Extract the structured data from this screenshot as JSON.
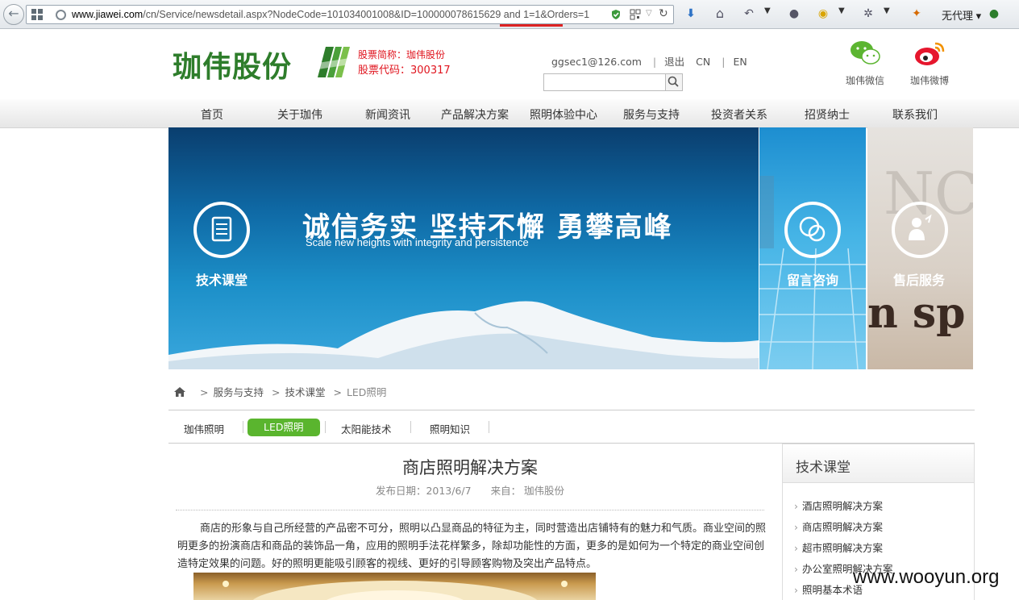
{
  "browser": {
    "url_domain": "www.jiawei.com",
    "url_path": "/cn/Service/newsdetail.aspx?NodeCode=101034001008&ID=100000078615629 and 1=1&Orders=1",
    "proxy_label": "无代理"
  },
  "header": {
    "logo_text": "珈伟股份",
    "stock_name": "股票简称：珈伟股份",
    "stock_code": "股票代码：300317",
    "user_email": "ggsec1@126.com",
    "logout": "退出",
    "lang_cn": "CN",
    "lang_en": "EN",
    "search_placeholder": "",
    "wechat_label": "珈伟微信",
    "weibo_label": "珈伟微博"
  },
  "menu": [
    "首页",
    "关于珈伟",
    "新闻资讯",
    "产品解决方案",
    "照明体验中心",
    "服务与支持",
    "投资者关系",
    "招贤纳士",
    "联系我们"
  ],
  "banner": {
    "left_label": "技术课堂",
    "slogan": "诚信务实  坚持不懈  勇攀高峰",
    "slogan_en": "Scale new heights with integrity and persistence",
    "side1_label": "留言咨询",
    "side2_label": "售后服务"
  },
  "breadcrumb": [
    "服务与支持",
    "技术课堂",
    "LED照明"
  ],
  "sub_tabs": [
    "珈伟照明",
    "LED照明",
    "太阳能技术",
    "照明知识"
  ],
  "article": {
    "title": "商店照明解决方案",
    "date": "发布日期：2013/6/7",
    "source": "来自： 珈伟股份",
    "body": "商店的形象与自己所经营的产品密不可分，照明以凸显商品的特征为主，同时营造出店铺特有的魅力和气质。商业空间的照明更多的扮演商店和商品的装饰品一角，应用的照明手法花样繁多，除却功能性的方面，更多的是如何为一个特定的商业空间创造特定效果的问题。好的照明更能吸引顾客的视线、更好的引导顾客购物及突出产品特点。"
  },
  "sidebar": {
    "title": "技术课堂",
    "items": [
      "酒店照明解决方案",
      "商店照明解决方案",
      "超市照明解决方案",
      "办公室照明解决方案",
      "照明基本术语"
    ]
  },
  "watermark": "www.wooyun.org",
  "colors": {
    "brand_green": "#2e7d2b",
    "stock_red": "#e0141e",
    "tab_active": "#5ab52e"
  }
}
